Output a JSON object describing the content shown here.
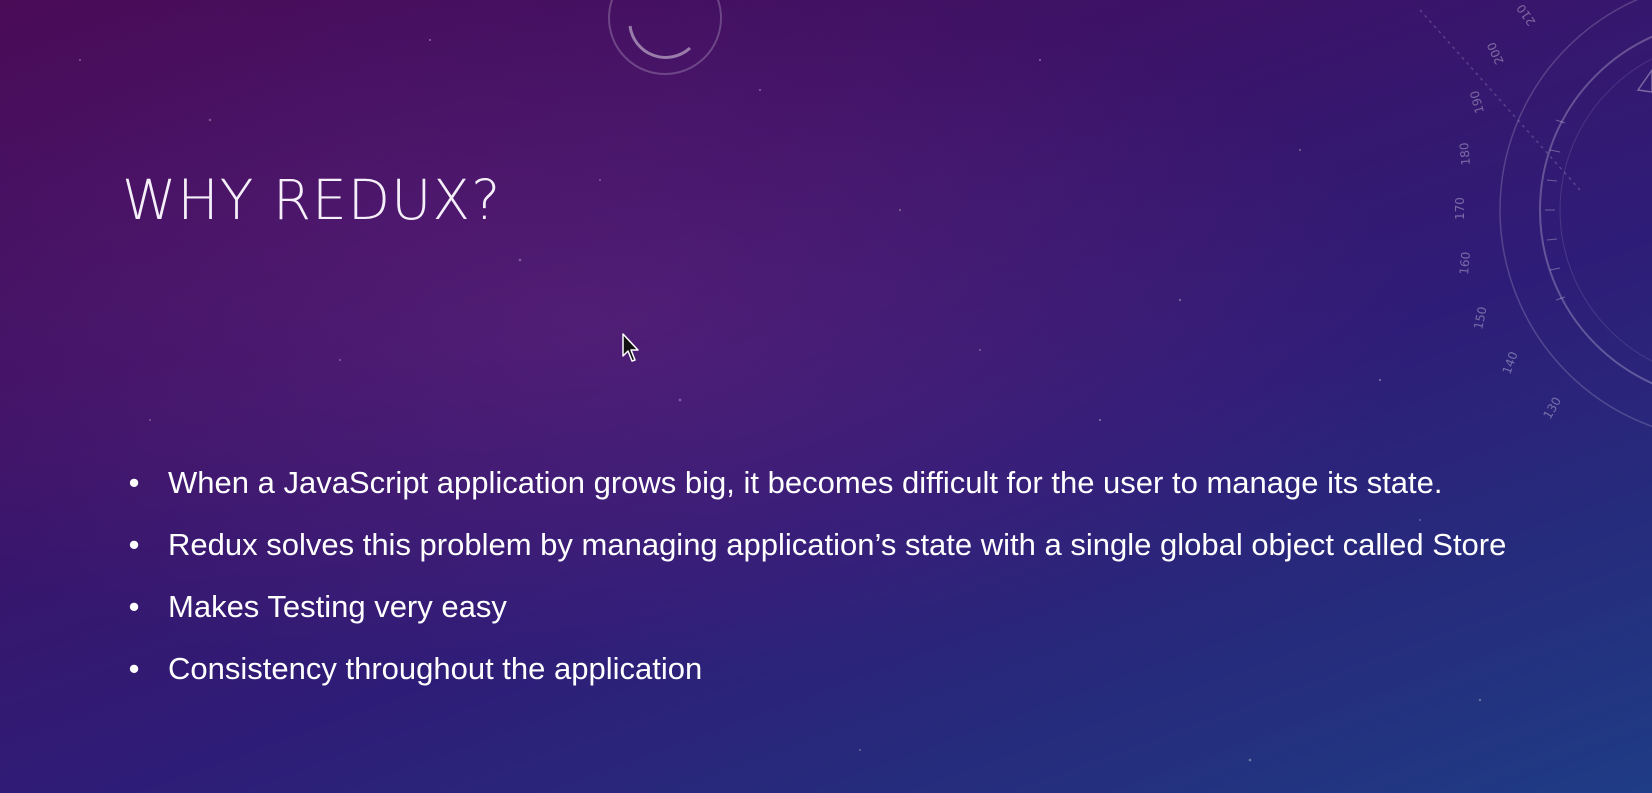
{
  "slide": {
    "title": "WHY REDUX?",
    "bullets": [
      "When a JavaScript application grows big, it becomes difficult for the user to manage its state.",
      "Redux solves this problem by managing application’s state with a single global object called Store",
      "Makes Testing very easy",
      "Consistency throughout the application"
    ]
  },
  "decoration": {
    "dial_numbers": [
      "130",
      "140",
      "150",
      "160",
      "170",
      "180",
      "190",
      "200",
      "210"
    ]
  },
  "colors": {
    "bg_top": "#4a0b57",
    "bg_bottom": "#1f3c86",
    "text": "#ffffff"
  }
}
